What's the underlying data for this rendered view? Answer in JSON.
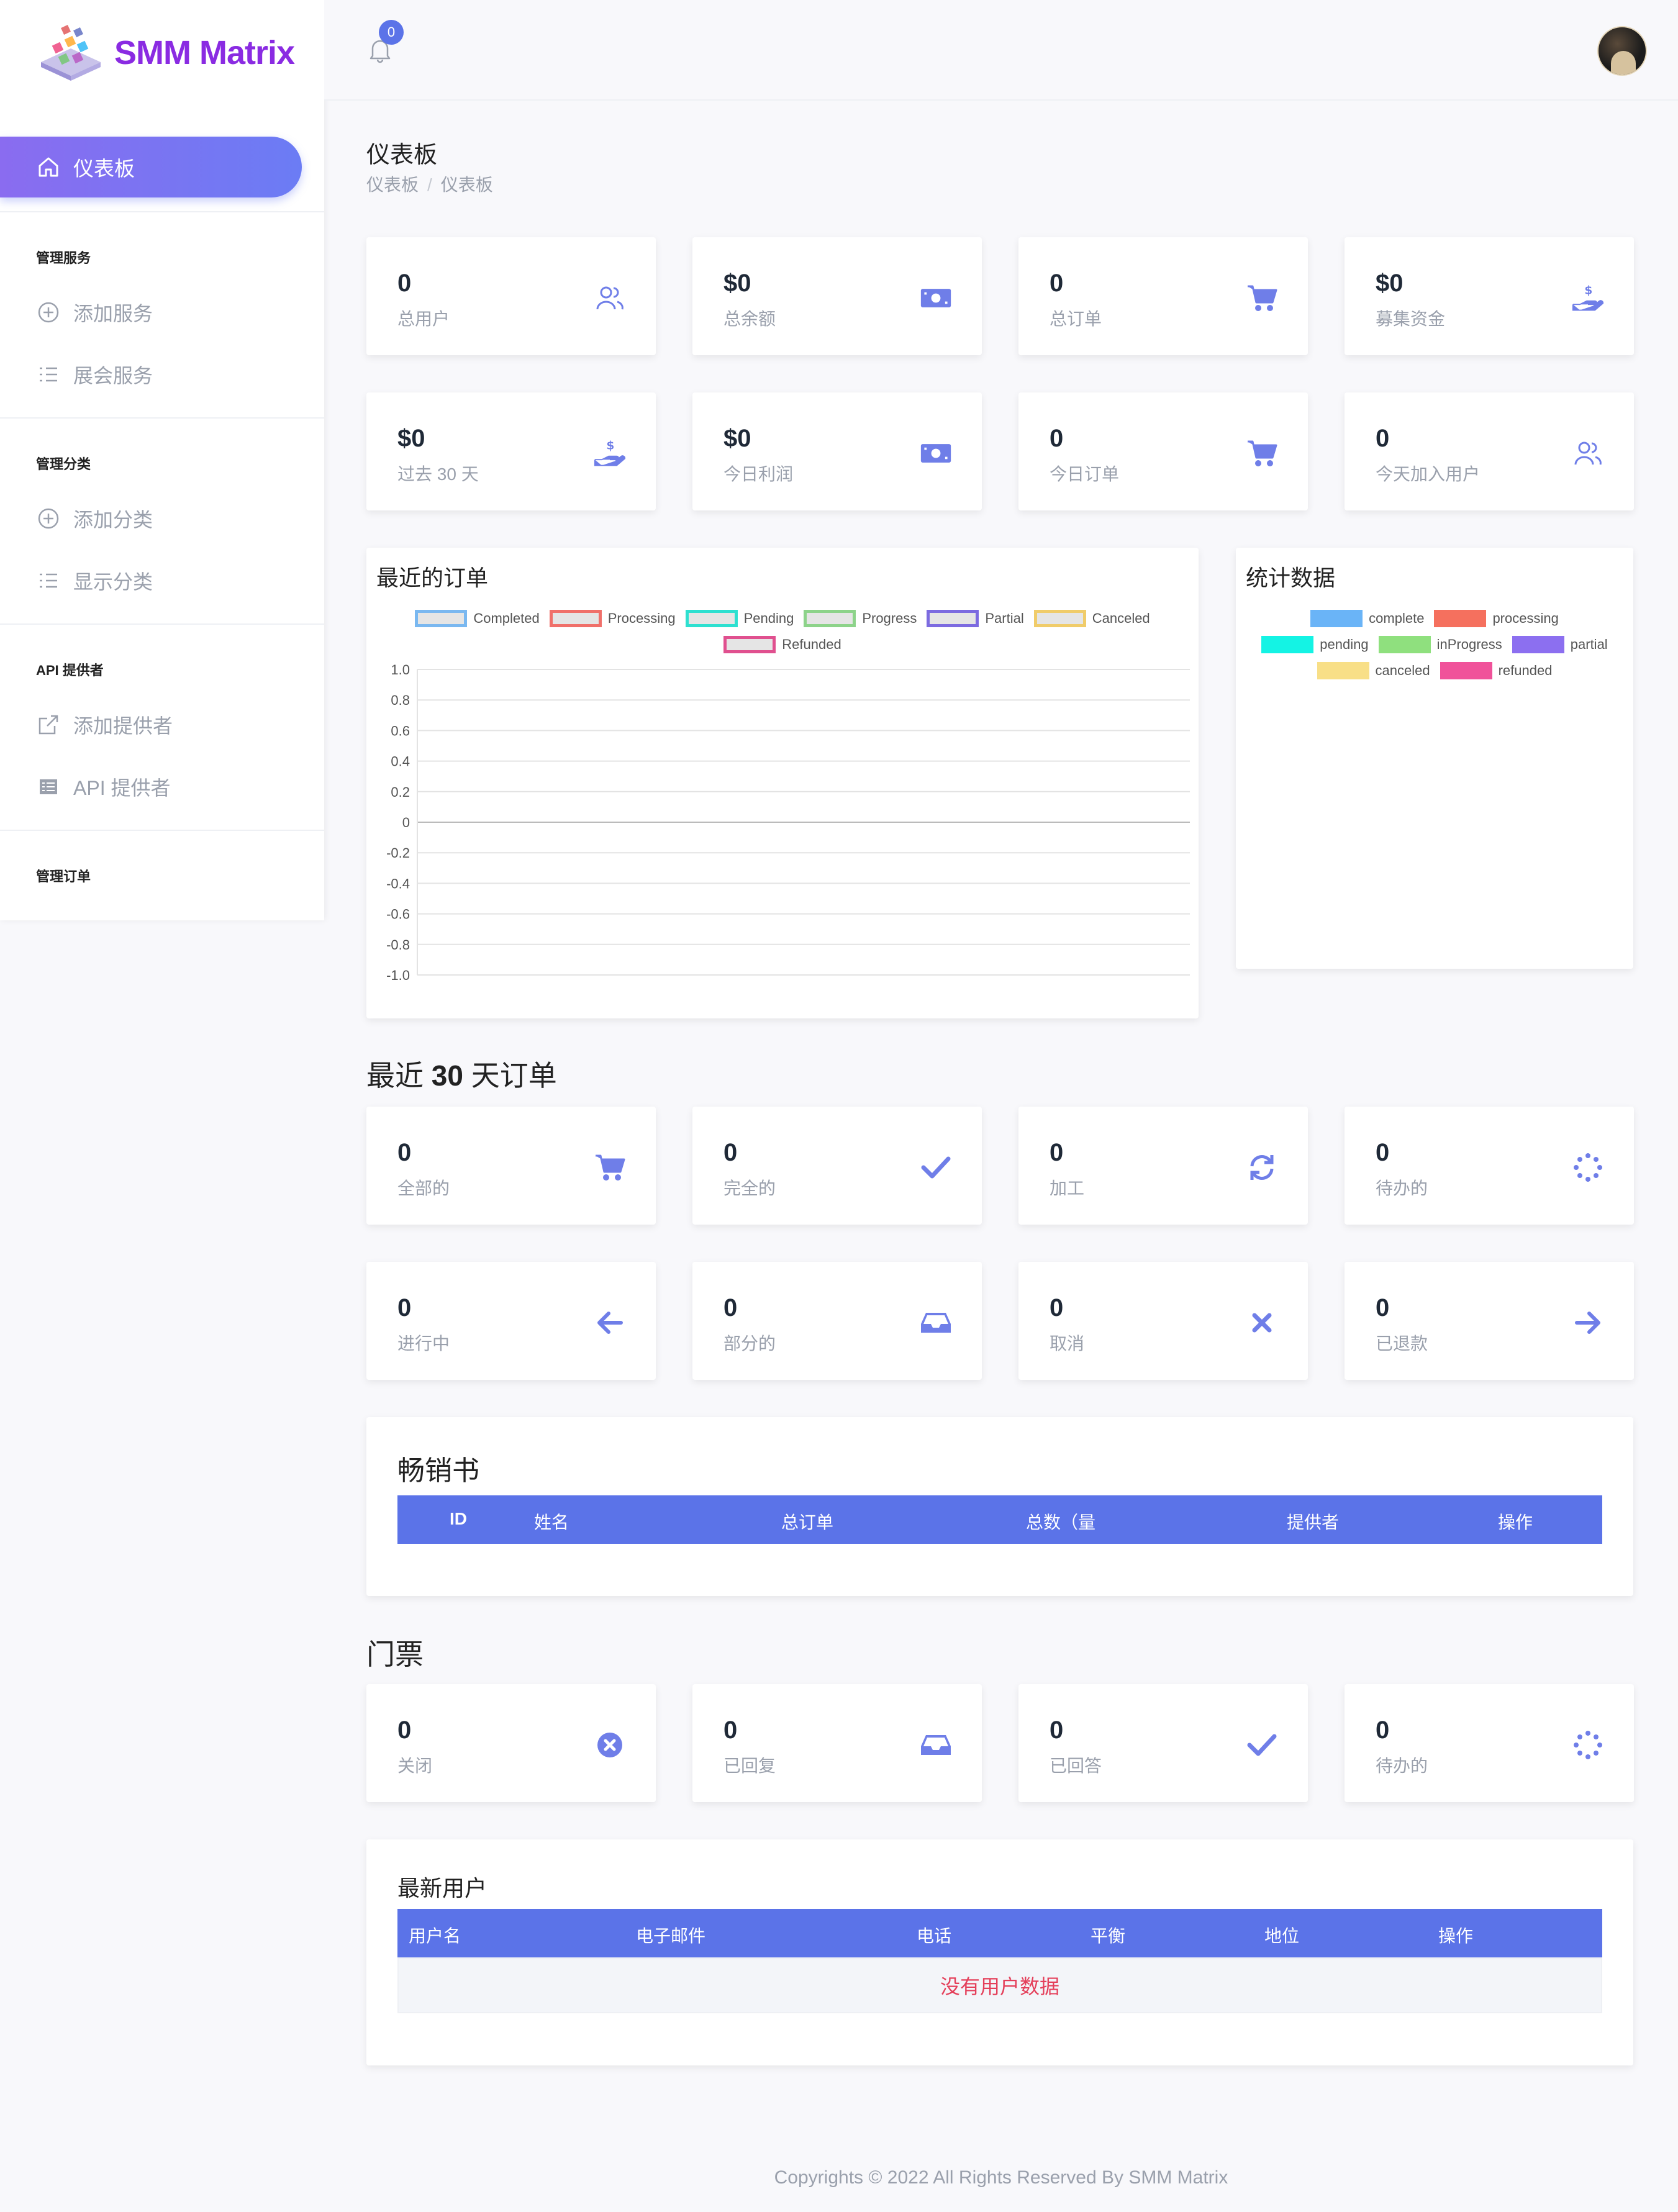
{
  "brand": {
    "name": "SMM Matrix"
  },
  "header": {
    "notification_count": "0"
  },
  "sidebar": {
    "active": {
      "label": "仪表板"
    },
    "sections": [
      {
        "heading": "管理服务",
        "items": [
          {
            "label": "添加服务",
            "icon": "plus-circle-icon"
          },
          {
            "label": "展会服务",
            "icon": "list-icon"
          }
        ]
      },
      {
        "heading": "管理分类",
        "items": [
          {
            "label": "添加分类",
            "icon": "plus-circle-icon"
          },
          {
            "label": "显示分类",
            "icon": "list-icon"
          }
        ]
      },
      {
        "heading": "API 提供者",
        "items": [
          {
            "label": "添加提供者",
            "icon": "external-link-icon"
          },
          {
            "label": "API 提供者",
            "icon": "table-icon"
          }
        ]
      },
      {
        "heading": "管理订单",
        "items": []
      }
    ]
  },
  "page": {
    "title": "仪表板",
    "breadcrumb": [
      "仪表板",
      "仪表板"
    ]
  },
  "stats_row1": [
    {
      "value": "0",
      "label": "总用户",
      "icon": "users-icon"
    },
    {
      "value": "$0",
      "label": "总余额",
      "icon": "money-bill-icon"
    },
    {
      "value": "0",
      "label": "总订单",
      "icon": "cart-icon"
    },
    {
      "value": "$0",
      "label": "募集资金",
      "icon": "hand-dollar-icon"
    }
  ],
  "stats_row2": [
    {
      "value": "$0",
      "label": "过去 30 天",
      "icon": "hand-dollar-icon"
    },
    {
      "value": "$0",
      "label": "今日利润",
      "icon": "money-bill-icon"
    },
    {
      "value": "0",
      "label": "今日订单",
      "icon": "cart-icon"
    },
    {
      "value": "0",
      "label": "今天加入用户",
      "icon": "users-icon"
    }
  ],
  "recent_orders_chart": {
    "title": "最近的订单",
    "legend": [
      {
        "name": "Completed",
        "color": "#7ab8f0"
      },
      {
        "name": "Processing",
        "color": "#f0706a"
      },
      {
        "name": "Pending",
        "color": "#2ee0d0"
      },
      {
        "name": "Progress",
        "color": "#8dd38a"
      },
      {
        "name": "Partial",
        "color": "#7c6be0"
      },
      {
        "name": "Canceled",
        "color": "#f0cc6a"
      },
      {
        "name": "Refunded",
        "color": "#e0508f"
      }
    ],
    "yticks": [
      "1.0",
      "0.8",
      "0.6",
      "0.4",
      "0.2",
      "0",
      "-0.2",
      "-0.4",
      "-0.6",
      "-0.8",
      "-1.0"
    ]
  },
  "stats_chart": {
    "title": "统计数据",
    "legend": [
      {
        "name": "complete",
        "color": "#6ab4f7"
      },
      {
        "name": "processing",
        "color": "#f5705e"
      },
      {
        "name": "pending",
        "color": "#14f3e4"
      },
      {
        "name": "inProgress",
        "color": "#8fe07e"
      },
      {
        "name": "partial",
        "color": "#8c6ff0"
      },
      {
        "name": "canceled",
        "color": "#f8df87"
      },
      {
        "name": "refunded",
        "color": "#f0529a"
      }
    ]
  },
  "last30": {
    "title_prefix": "最近",
    "title_num": "30",
    "title_suffix": "天订单",
    "row1": [
      {
        "value": "0",
        "label": "全部的",
        "icon": "cart-icon"
      },
      {
        "value": "0",
        "label": "完全的",
        "icon": "check-icon"
      },
      {
        "value": "0",
        "label": "加工",
        "icon": "sync-icon"
      },
      {
        "value": "0",
        "label": "待办的",
        "icon": "spinner-icon"
      }
    ],
    "row2": [
      {
        "value": "0",
        "label": "进行中",
        "icon": "arrow-left-icon"
      },
      {
        "value": "0",
        "label": "部分的",
        "icon": "inbox-icon"
      },
      {
        "value": "0",
        "label": "取消",
        "icon": "times-icon"
      },
      {
        "value": "0",
        "label": "已退款",
        "icon": "arrow-right-icon"
      }
    ]
  },
  "bestsellers": {
    "title": "畅销书",
    "columns": [
      "ID",
      "姓名",
      "总订单",
      "总数（量",
      "提供者",
      "操作"
    ]
  },
  "tickets": {
    "title": "门票",
    "cards": [
      {
        "value": "0",
        "label": "关闭",
        "icon": "times-circle-icon"
      },
      {
        "value": "0",
        "label": "已回复",
        "icon": "inbox-icon"
      },
      {
        "value": "0",
        "label": "已回答",
        "icon": "check-icon"
      },
      {
        "value": "0",
        "label": "待办的",
        "icon": "spinner-icon"
      }
    ]
  },
  "latest_users": {
    "title": "最新用户",
    "columns": [
      "用户名",
      "电子邮件",
      "电话",
      "平衡",
      "地位",
      "操作"
    ],
    "empty_text": "没有用户数据"
  },
  "footer": {
    "text": "Copyrights © 2022 All Rights Reserved By SMM Matrix"
  }
}
